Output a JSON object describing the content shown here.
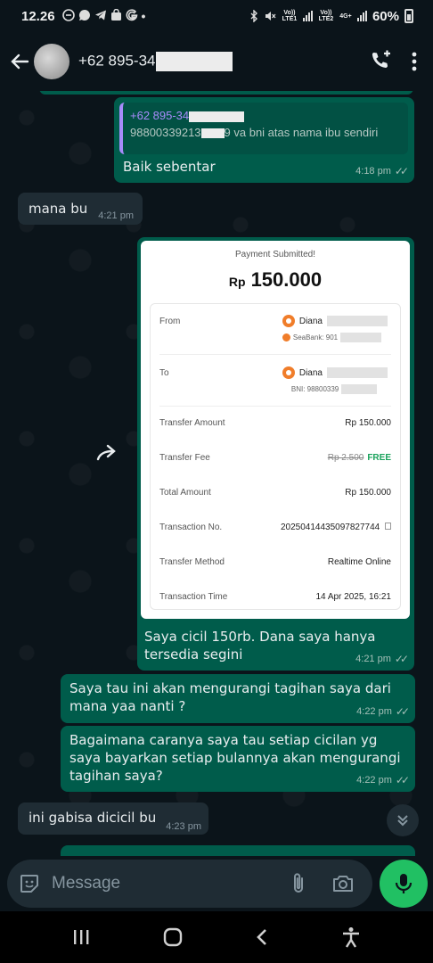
{
  "status_bar": {
    "time": "12.26",
    "network_labels": [
      "Vo)) LTE1",
      "Vo)) LTE2",
      "4G+"
    ],
    "battery": "60%"
  },
  "header": {
    "contact_name": "+62 895-34",
    "icons": [
      "back-arrow-icon",
      "add-call-icon",
      "more-vert-icon"
    ]
  },
  "messages": [
    {
      "type": "outgoing_reply",
      "quote_name": "+62 895-34",
      "quote_text_a": "98800339213",
      "quote_text_b": "9 va bni atas nama ibu sendiri",
      "text": "Baik sebentar",
      "time": "4:18 pm"
    },
    {
      "type": "incoming",
      "text": "mana bu",
      "time": "4:21 pm"
    },
    {
      "type": "outgoing_image",
      "receipt": {
        "title": "Payment Submitted!",
        "currency": "Rp",
        "amount": "150.000",
        "from_label": "From",
        "from_name": "Diana",
        "from_bank": "SeaBank: 901",
        "to_label": "To",
        "to_name": "Diana",
        "to_bank": "BNI: 98800339",
        "transfer_amount_label": "Transfer Amount",
        "transfer_amount": "Rp 150.000",
        "transfer_fee_label": "Transfer Fee",
        "transfer_fee_old": "Rp 2.500",
        "transfer_fee_new": "FREE",
        "total_label": "Total Amount",
        "total": "Rp 150.000",
        "txn_no_label": "Transaction No.",
        "txn_no": "20250414435097827744",
        "method_label": "Transfer Method",
        "method": "Realtime Online",
        "txn_time_label": "Transaction Time",
        "txn_time": "14 Apr 2025, 16:21"
      },
      "caption_line1": "Saya cicil 150rb. Dana saya hanya",
      "caption_line2": "tersedia segini",
      "time": "4:21 pm"
    },
    {
      "type": "outgoing",
      "line1": "Saya tau ini akan mengurangi tagihan saya dari",
      "line2": "mana yaa nanti ?",
      "time": "4:22 pm"
    },
    {
      "type": "outgoing",
      "line1": "Bagaimana caranya saya tau setiap cicilan yg",
      "line2": "saya bayarkan setiap bulannya akan mengurangi",
      "line3": "tagihan saya?",
      "time": "4:22 pm"
    },
    {
      "type": "incoming",
      "text": "ini gabisa dicicil bu",
      "time": "4:23 pm"
    }
  ],
  "composer": {
    "placeholder": "Message",
    "icons": [
      "sticker-icon",
      "attach-icon",
      "camera-icon",
      "mic-icon"
    ]
  },
  "nav": {
    "icons": [
      "recents-icon",
      "home-icon",
      "back-icon",
      "accessibility-icon"
    ]
  }
}
